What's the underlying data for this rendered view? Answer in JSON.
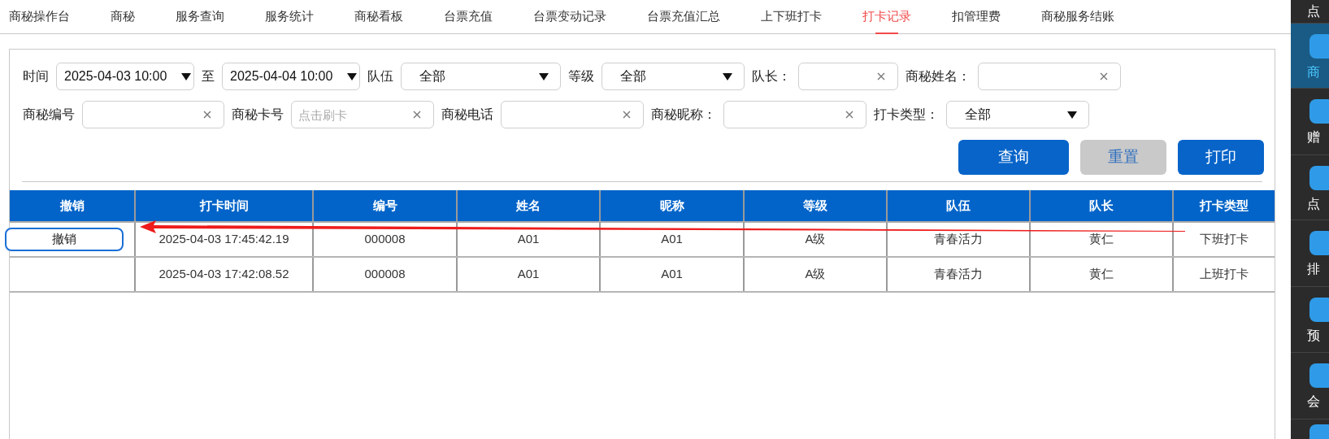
{
  "tabs": [
    {
      "label": "商秘操作台",
      "selected": false
    },
    {
      "label": "商秘",
      "selected": false
    },
    {
      "label": "服务查询",
      "selected": false
    },
    {
      "label": "服务统计",
      "selected": false
    },
    {
      "label": "商秘看板",
      "selected": false
    },
    {
      "label": "台票充值",
      "selected": false
    },
    {
      "label": "台票变动记录",
      "selected": false
    },
    {
      "label": "台票充值汇总",
      "selected": false
    },
    {
      "label": "上下班打卡",
      "selected": false
    },
    {
      "label": "打卡记录",
      "selected": true
    },
    {
      "label": "扣管理费",
      "selected": false
    },
    {
      "label": "商秘服务结账",
      "selected": false
    }
  ],
  "filters": [
    [
      {
        "kind": "date",
        "label": "时间",
        "value": "2025-04-03 10:00"
      },
      {
        "kind": "date",
        "label": "至",
        "value": "2025-04-04 10:00"
      },
      {
        "kind": "select",
        "label": "队伍",
        "value": "全部"
      },
      {
        "kind": "select",
        "label": "等级",
        "value": "全部"
      },
      {
        "kind": "text",
        "label": "队长："
      },
      {
        "kind": "text",
        "label": "商秘姓名："
      }
    ],
    [
      {
        "kind": "text",
        "label": "商秘编号"
      },
      {
        "kind": "text",
        "label": "商秘卡号",
        "placeholder": "点击刷卡"
      },
      {
        "kind": "text",
        "label": "商秘电话"
      },
      {
        "kind": "text",
        "label": "商秘昵称："
      },
      {
        "kind": "select",
        "label": "打卡类型：",
        "value": "全部"
      }
    ]
  ],
  "buttons": [
    {
      "label": "查询",
      "disabled": false
    },
    {
      "label": "重置",
      "disabled": true
    },
    {
      "label": "打印",
      "disabled": false
    }
  ],
  "table": {
    "columns": [
      "撤销",
      "打卡时间",
      "编号",
      "姓名",
      "昵称",
      "等级",
      "队伍",
      "队长",
      "打卡类型"
    ],
    "rows": [
      {
        "cells": [
          "撤销",
          "2025-04-03 17:45:42.19",
          "000008",
          "A01",
          "A01",
          "A级",
          "青春活力",
          "黄仁",
          "下班打卡"
        ]
      },
      {
        "cells": [
          "",
          "2025-04-03 17:42:08.52",
          "000008",
          "A01",
          "A01",
          "A级",
          "青春活力",
          "黄仁",
          "上班打卡"
        ]
      }
    ]
  },
  "sidebar": {
    "items": [
      {
        "label": "点",
        "selected": false
      },
      {
        "label": "商",
        "selected": true
      },
      {
        "label": "赠",
        "selected": false
      },
      {
        "label": "点",
        "selected": false
      },
      {
        "label": "排",
        "selected": false
      },
      {
        "label": "预",
        "selected": false
      },
      {
        "label": "会",
        "selected": false
      },
      {
        "selected": false
      }
    ]
  }
}
